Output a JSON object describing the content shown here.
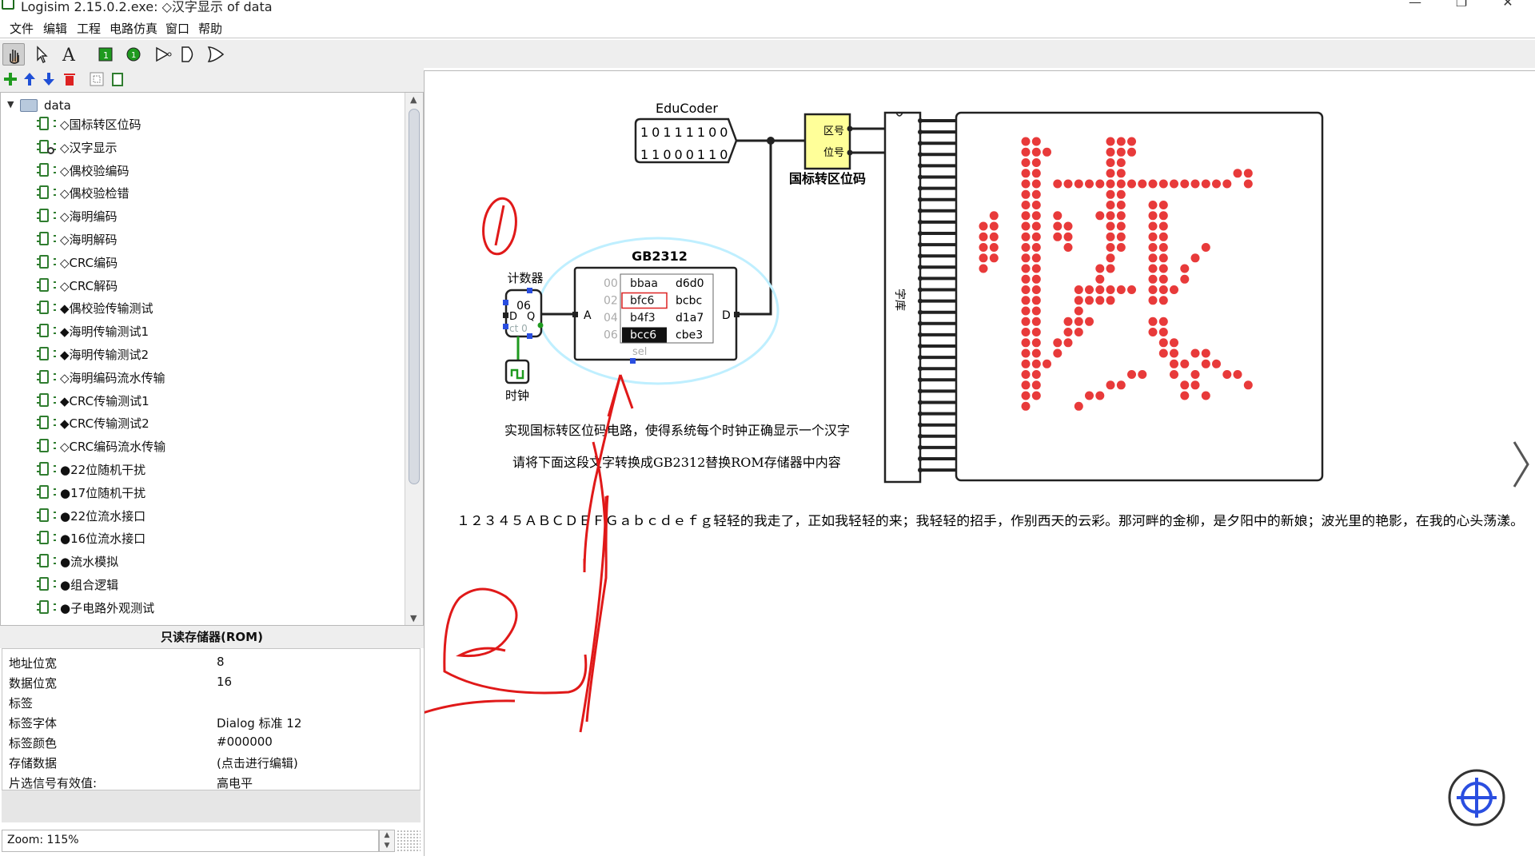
{
  "window": {
    "title": "Logisim 2.15.0.2.exe: ◇汉字显示 of data"
  },
  "menu": [
    "文件",
    "编辑",
    "工程",
    "电路仿真",
    "窗口",
    "帮助"
  ],
  "explorer": {
    "root": "data",
    "items": [
      "◇国标转区位码",
      "◇汉字显示",
      "◇偶校验编码",
      "◇偶校验检错",
      "◇海明编码",
      "◇海明解码",
      "◇CRC编码",
      "◇CRC解码",
      "◆偶校验传输测试",
      "◆海明传输测试1",
      "◆海明传输测试2",
      "◇海明编码流水传输",
      "◆CRC传输测试1",
      "◆CRC传输测试2",
      "◇CRC编码流水传输",
      "●22位随机干扰",
      "●17位随机干扰",
      "●22位流水接口",
      "●16位流水接口",
      "●流水模拟",
      "●组合逻辑",
      "●子电路外观测试"
    ]
  },
  "attributes": {
    "title": "只读存储器(ROM)",
    "rows": [
      {
        "key": "地址位宽",
        "value": "8"
      },
      {
        "key": "数据位宽",
        "value": "16"
      },
      {
        "key": "标签",
        "value": ""
      },
      {
        "key": "标签字体",
        "value": "Dialog 标准 12"
      },
      {
        "key": "标签颜色",
        "value": "#000000"
      },
      {
        "key": "存储数据",
        "value": "(点击进行编辑)"
      },
      {
        "key": "片选信号有效值:",
        "value": "高电平"
      }
    ]
  },
  "zoom": {
    "label": "Zoom: 115%"
  },
  "circuit": {
    "educoder": {
      "label": "EduCoder",
      "row1": "10111100",
      "row2": "11000110"
    },
    "converter": {
      "label": "国标转区位码",
      "pin1": "区号",
      "pin2": "位号"
    },
    "counter": {
      "label": "计数器",
      "value": "06",
      "d": "D",
      "q": "Q",
      "ct": "ct 0"
    },
    "clock": {
      "label": "时钟"
    },
    "rom": {
      "title": "GB2312",
      "addrs": [
        "00",
        "02",
        "04",
        "06"
      ],
      "col1": [
        "bbaa",
        "bfc6",
        "b4f3",
        "bcc6"
      ],
      "col2": [
        "d6d0",
        "bcbc",
        "d1a7",
        "cbe3"
      ],
      "pin_a": "A",
      "pin_d": "D",
      "sel": "sel"
    },
    "font_lib_label": "字库",
    "instr1": "实现国标转区位码电路，使得系统每个时钟正确显示一个汉字",
    "instr2": "请将下面这段文字转换成GB2312替换ROM存储器中内容",
    "sample_text": "１２３４５ＡＢＣＤＥＦＧａｂｃｄｅｆｇ轻轻的我走了，正如我轻轻的来；我轻轻的招手，作别西天的云彩。那河畔的金柳，是夕阳中的新娘；波光里的艳影，在我的心头荡漾。",
    "annot1": "①",
    "annot2": "②"
  },
  "colors": {
    "accent_green": "#2f7d2f",
    "led_red": "#e83a3a",
    "annotation": "#e01919",
    "selection_ring": "#bfefff"
  }
}
